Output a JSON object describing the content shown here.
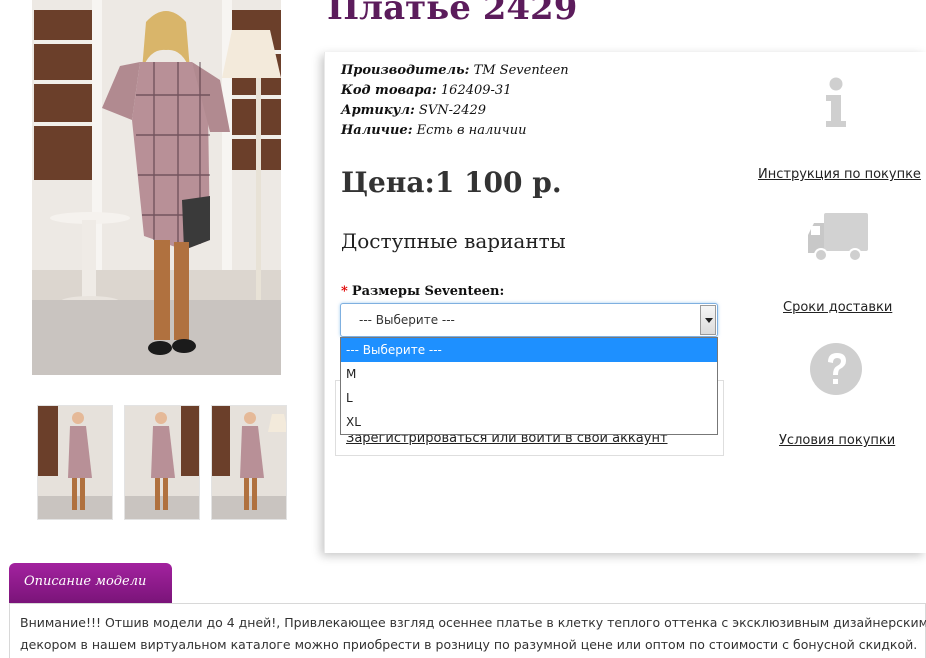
{
  "product": {
    "title": "Платье 2429",
    "meta": [
      {
        "key": "Производитель:",
        "value": "TM Seventeen"
      },
      {
        "key": "Код товара:",
        "value": "162409-31"
      },
      {
        "key": "Артикул:",
        "value": "SVN-2429"
      },
      {
        "key": "Наличие:",
        "value": "Есть в наличии"
      }
    ],
    "price": "Цена:1 100 р.",
    "variants_title": "Доступные варианты"
  },
  "size_select": {
    "required_mark": "*",
    "label": "Размеры Seventeen:",
    "selected": "--- Выберите ---",
    "options": [
      "--- Выберите ---",
      "M",
      "L",
      "XL"
    ]
  },
  "account": {
    "login_link": "Зарегистрироваться или войти в свой аккаунт"
  },
  "side_info": {
    "instruction": "Инструкция по покупке",
    "delivery": "Сроки доставки",
    "conditions": "Условия покупки"
  },
  "description": {
    "tab_label": "Описание модели",
    "lines": [
      "Внимание!!! Отшив модели до 4 дней!, Привлекающее взгляд осеннее платье в клетку теплого оттенка с эксклюзивным дизайнерским",
      "декором в нашем виртуальном каталоге можно приобрести в розницу по разумной цене или оптом по стоимости с бонусной скидкой."
    ]
  },
  "colors": {
    "title": "#5c1c5c",
    "tab": "#8e1b8c",
    "select_highlight": "#1e90ff",
    "icon_gray": "#d0d0d0"
  }
}
